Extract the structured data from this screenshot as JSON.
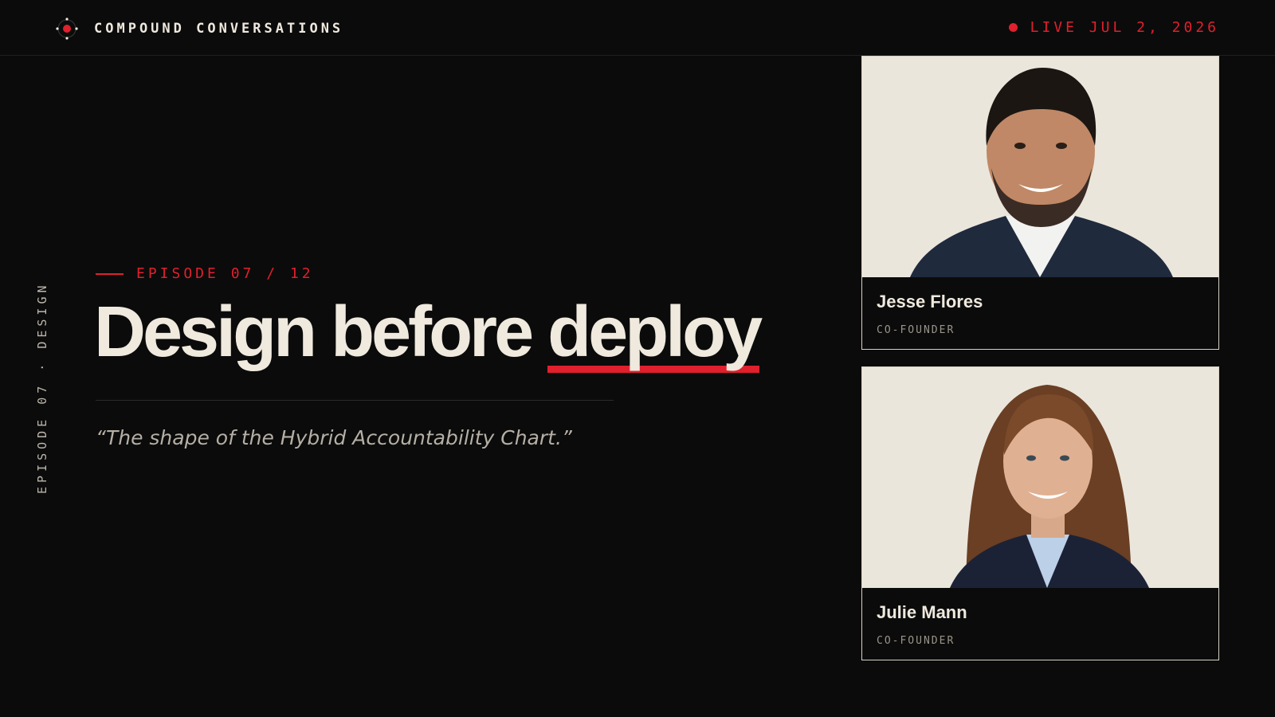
{
  "header": {
    "brand_name": "COMPOUND CONVERSATIONS",
    "brand_icon": "orbit-logo-icon",
    "live_label": "LIVE JUL 2, 2026",
    "live_icon": "live-dot-icon"
  },
  "side_label": {
    "episode": "EPISODE 07",
    "separator": "·",
    "topic": "DESIGN"
  },
  "main": {
    "episode_tag": "EPISODE 07 / 12",
    "headline_part1": "Design before ",
    "headline_accent": "deploy",
    "quote": "“The shape of the Hybrid Accountability Chart.”"
  },
  "speakers": [
    {
      "name": "Jesse Flores",
      "role": "CO-FOUNDER",
      "photo": "man-portrait"
    },
    {
      "name": "Julie Mann",
      "role": "CO-FOUNDER",
      "photo": "woman-portrait"
    }
  ],
  "colors": {
    "background": "#0b0b0b",
    "accent": "#e0202d",
    "text": "#efe9de",
    "muted": "#b5afa5",
    "photo_bg": "#ebe6dc"
  }
}
